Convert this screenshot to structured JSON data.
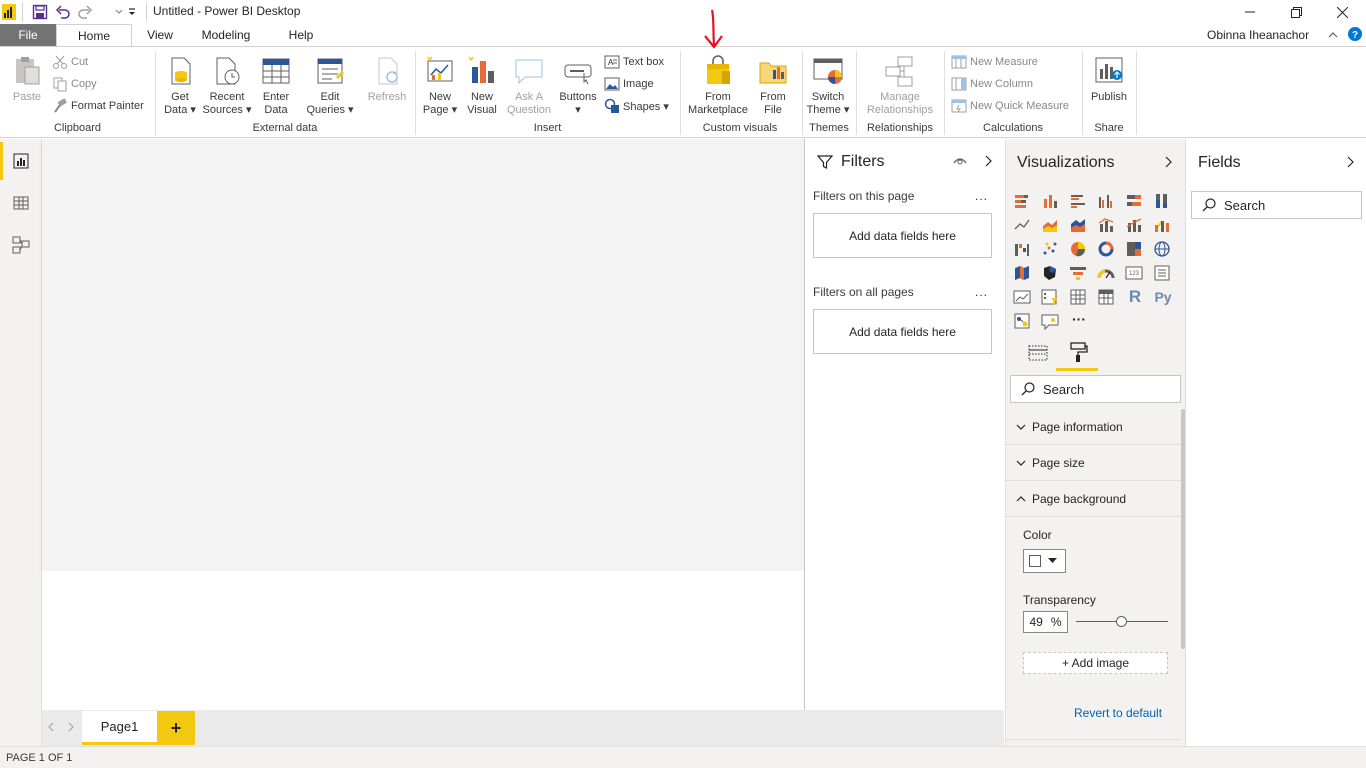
{
  "window": {
    "title": "Untitled - Power BI Desktop"
  },
  "tabs": {
    "file": "File",
    "home": "Home",
    "view": "View",
    "modeling": "Modeling",
    "help": "Help"
  },
  "user": {
    "name": "Obinna Iheanachor"
  },
  "ribbon": {
    "clipboard": {
      "paste": "Paste",
      "cut": "Cut",
      "copy": "Copy",
      "format_painter": "Format Painter",
      "label": "Clipboard"
    },
    "external_data": {
      "get_data_1": "Get",
      "get_data_2": "Data",
      "recent_1": "Recent",
      "recent_2": "Sources",
      "enter_1": "Enter",
      "enter_2": "Data",
      "edit_1": "Edit",
      "edit_2": "Queries",
      "refresh": "Refresh",
      "label": "External data"
    },
    "insert": {
      "new_page_1": "New",
      "new_page_2": "Page",
      "new_visual_1": "New",
      "new_visual_2": "Visual",
      "ask_1": "Ask A",
      "ask_2": "Question",
      "buttons": "Buttons",
      "text_box": "Text box",
      "image": "Image",
      "shapes": "Shapes",
      "label": "Insert"
    },
    "custom_visuals": {
      "marketplace_1": "From",
      "marketplace_2": "Marketplace",
      "file_1": "From",
      "file_2": "File",
      "label": "Custom visuals"
    },
    "themes": {
      "switch_1": "Switch",
      "switch_2": "Theme",
      "label": "Themes"
    },
    "relationships": {
      "manage_1": "Manage",
      "manage_2": "Relationships",
      "label": "Relationships"
    },
    "calculations": {
      "new_measure": "New Measure",
      "new_column": "New Column",
      "new_quick_measure": "New Quick Measure",
      "label": "Calculations"
    },
    "share": {
      "publish": "Publish",
      "label": "Share"
    }
  },
  "filters": {
    "title": "Filters",
    "on_this_page": "Filters on this page",
    "on_all_pages": "Filters on all pages",
    "dropzone": "Add data fields here",
    "more": "..."
  },
  "visualizations": {
    "title": "Visualizations",
    "more": "···",
    "search_placeholder": "Search",
    "sections": {
      "page_information": "Page information",
      "page_size": "Page size",
      "page_background": "Page background"
    },
    "color_label": "Color",
    "transparency_label": "Transparency",
    "transparency_value": "49",
    "transparency_unit": "%",
    "transparency_fraction": 0.49,
    "add_image": "+ Add image",
    "revert": "Revert to default",
    "r_label": "R",
    "py_label": "Py"
  },
  "fields": {
    "title": "Fields",
    "search_placeholder": "Search"
  },
  "pages": {
    "page1": "Page1",
    "add": "+"
  },
  "status": {
    "text": "PAGE 1 OF 1"
  },
  "colors": {
    "accent_yellow": "#f2c811",
    "annotation_red": "#e81123",
    "file_tab": "#737373"
  }
}
